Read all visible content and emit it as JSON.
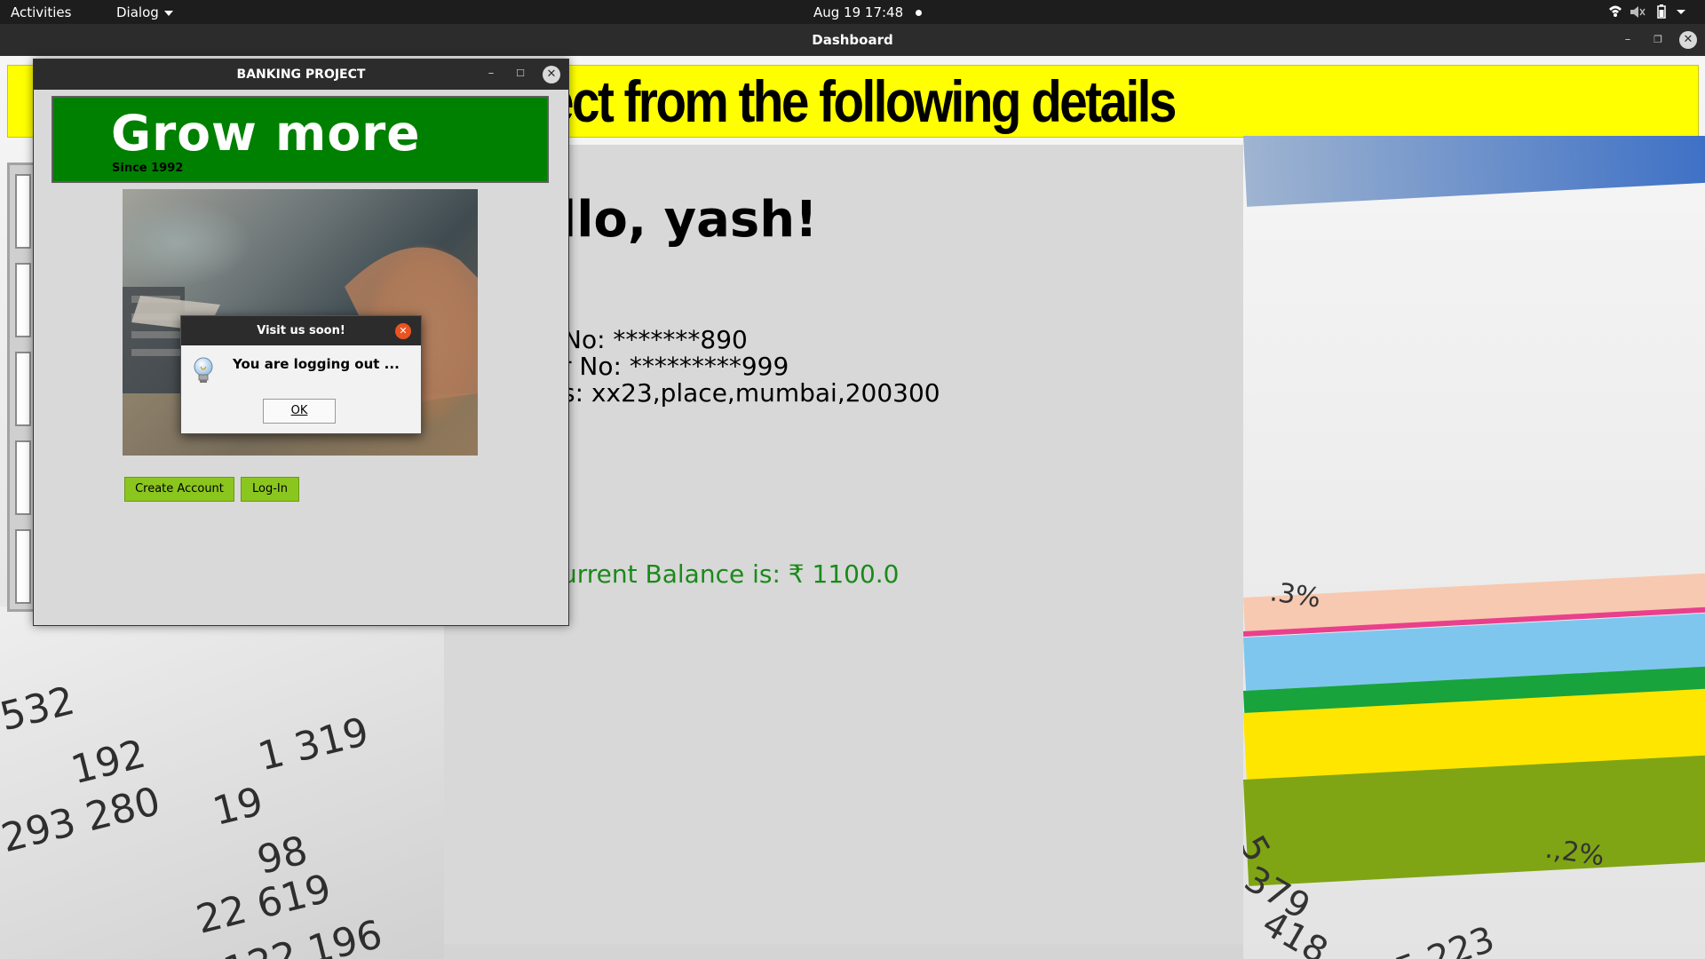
{
  "topbar": {
    "activities": "Activities",
    "app_menu": "Dialog",
    "datetime": "Aug 19  17:48"
  },
  "dashboard": {
    "window_title": "Dashboard",
    "banner": "ect from the following details",
    "greeting": "llo, yash!",
    "account_line": "No: *******890",
    "phone_line": "r No: *********999",
    "address_line": "s:  xx23,place,mumbai,200300",
    "balance_line": "urrent Balance is: ₹ 1100.0",
    "background_numbers": [
      "532",
      "192",
      "1 319",
      "293 280",
      "19",
      "98",
      "22 619",
      "122 196",
      "379",
      "418",
      "5 223",
      "5"
    ],
    "background_percents": [
      ".3%",
      ".,2%"
    ]
  },
  "bank_window": {
    "title": "BANKING PROJECT",
    "logo_title": "Grow more",
    "logo_subtitle": "Since 1992",
    "create_account_label": "Create Account",
    "login_label": "Log-In"
  },
  "dialog": {
    "title": "Visit us soon!",
    "message": "You are logging out ...",
    "ok_label": "OK",
    "icon": "lightbulb-icon"
  },
  "colors": {
    "banner_yellow": "#ffff00",
    "logo_green": "#008000",
    "button_green": "#8bc61e",
    "balance_green": "#1a8a1a",
    "close_orange": "#e95420"
  }
}
